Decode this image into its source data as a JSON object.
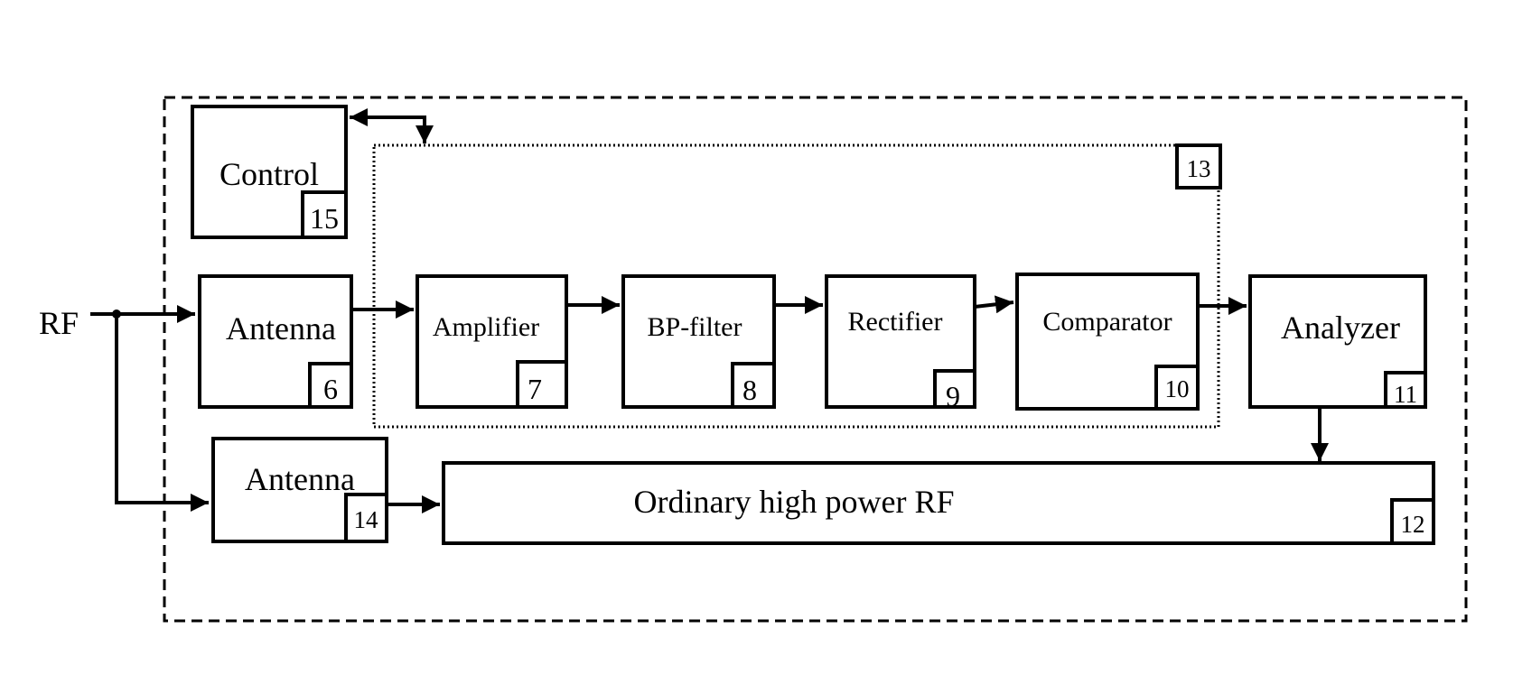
{
  "diagram": {
    "input_label": "RF",
    "group_label": "13",
    "blocks": [
      {
        "id": "control",
        "label": "Control",
        "number": "15"
      },
      {
        "id": "antenna_rx",
        "label": "Antenna",
        "number": "6"
      },
      {
        "id": "amplifier",
        "label": "Amplifier",
        "number": "7"
      },
      {
        "id": "bp_filter",
        "label": "BP-filter",
        "number": "8"
      },
      {
        "id": "rectifier",
        "label": "Rectifier",
        "number": "9"
      },
      {
        "id": "comparator",
        "label": "Comparator",
        "number": "10"
      },
      {
        "id": "analyzer",
        "label": "Analyzer",
        "number": "11"
      },
      {
        "id": "high_power_rf",
        "label": "Ordinary high power RF",
        "number": "12"
      },
      {
        "id": "antenna_tx",
        "label": "Antenna",
        "number": "14"
      }
    ],
    "connections": [
      {
        "from": "RF",
        "to": "antenna_rx"
      },
      {
        "from": "RF",
        "to": "antenna_tx"
      },
      {
        "from": "antenna_rx",
        "to": "amplifier"
      },
      {
        "from": "amplifier",
        "to": "bp_filter"
      },
      {
        "from": "bp_filter",
        "to": "rectifier"
      },
      {
        "from": "rectifier",
        "to": "comparator"
      },
      {
        "from": "comparator",
        "to": "analyzer"
      },
      {
        "from": "analyzer",
        "to": "high_power_rf"
      },
      {
        "from": "antenna_tx",
        "to": "high_power_rf"
      },
      {
        "from": "control",
        "to": "group_13",
        "bidirectional": true
      }
    ]
  }
}
